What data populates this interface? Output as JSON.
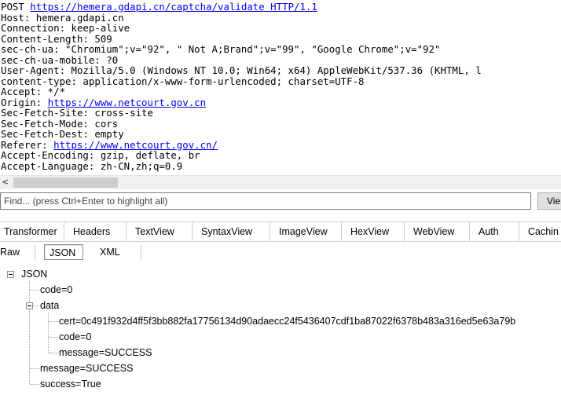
{
  "raw_request": {
    "method": "POST ",
    "url": "https://hemera.gdapi.cn/captcha/validate HTTP/1.1",
    "line_host": "Host: hemera.gdapi.cn",
    "line_connection": "Connection: keep-alive",
    "line_content_length": "Content-Length: 509",
    "line_sec_ch_ua": "sec-ch-ua: \"Chromium\";v=\"92\", \" Not A;Brand\";v=\"99\", \"Google Chrome\";v=\"92\"",
    "line_sec_ch_ua_mobile": "sec-ch-ua-mobile: ?0",
    "line_user_agent": "User-Agent: Mozilla/5.0 (Windows NT 10.0; Win64; x64) AppleWebKit/537.36 (KHTML, l",
    "line_content_type": "content-type: application/x-www-form-urlencoded; charset=UTF-8",
    "line_accept": "Accept: */*",
    "origin_label": "Origin: ",
    "origin_url": "https://www.netcourt.gov.cn",
    "line_sec_fetch_site": "Sec-Fetch-Site: cross-site",
    "line_sec_fetch_mode": "Sec-Fetch-Mode: cors",
    "line_sec_fetch_dest": "Sec-Fetch-Dest: empty",
    "referer_label": "Referer: ",
    "referer_url": "https://www.netcourt.gov.cn/",
    "line_accept_encoding": "Accept-Encoding: gzip, deflate, br",
    "line_accept_language": "Accept-Language: zh-CN,zh;q=0.9"
  },
  "scroll_left_arrow": "<",
  "find": {
    "placeholder": "Find... (press Ctrl+Enter to highlight all)",
    "view_button": "Vie"
  },
  "inspector_tabs": [
    "Transformer",
    "Headers",
    "TextView",
    "SyntaxView",
    "ImageView",
    "HexView",
    "WebView",
    "Auth",
    "Cachin"
  ],
  "format_tabs": {
    "raw": "Raw",
    "json": "JSON",
    "xml": "XML",
    "active": "JSON"
  },
  "tree": {
    "root": "JSON",
    "code": "code=0",
    "data": "data",
    "data_cert": "cert=0c491f932d4ff5f3bb882fa17756134d90adaecc24f5436407cdf1ba87022f6378b483a316ed5e63a79b",
    "data_code": "code=0",
    "data_message": "message=SUCCESS",
    "message": "message=SUCCESS",
    "success": "success=True"
  }
}
